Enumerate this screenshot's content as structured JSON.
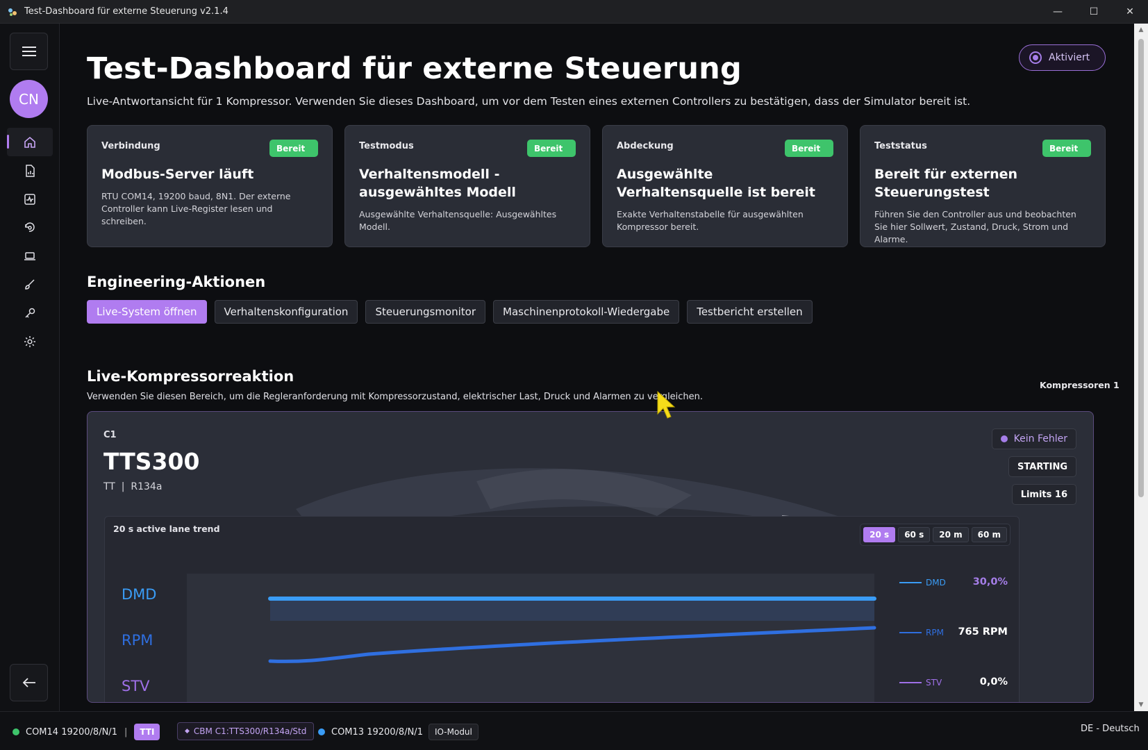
{
  "window": {
    "title": "Test-Dashboard für externe Steuerung v2.1.4",
    "minimize": "—",
    "maximize": "☐",
    "close": "✕"
  },
  "sidebar": {
    "avatar_initials": "CN",
    "items": [
      {
        "icon": "home-icon",
        "active": true
      },
      {
        "icon": "document-chart-icon",
        "active": false
      },
      {
        "icon": "activity-icon",
        "active": false
      },
      {
        "icon": "refresh-search-icon",
        "active": false
      },
      {
        "icon": "laptop-icon",
        "active": false
      },
      {
        "icon": "brush-icon",
        "active": false
      },
      {
        "icon": "key-icon",
        "active": false
      },
      {
        "icon": "gear-icon",
        "active": false
      }
    ]
  },
  "header": {
    "title": "Test-Dashboard für externe Steuerung",
    "subtitle": "Live-Antwortansicht für 1 Kompressor. Verwenden Sie dieses Dashboard, um vor dem Testen eines externen Controllers zu bestätigen, dass der Simulator bereit ist.",
    "status_pill": "Aktiviert"
  },
  "cards": [
    {
      "label": "Verbindung",
      "badge": "Bereit",
      "title": "Modbus-Server läuft",
      "desc": "RTU COM14, 19200 baud, 8N1. Der externe Controller kann Live-Register lesen und schreiben."
    },
    {
      "label": "Testmodus",
      "badge": "Bereit",
      "title": "Verhaltensmodell - ausgewähltes Modell",
      "desc": "Ausgewählte Verhaltensquelle: Ausgewähltes Modell."
    },
    {
      "label": "Abdeckung",
      "badge": "Bereit",
      "title": "Ausgewählte Verhaltensquelle ist bereit",
      "desc": "Exakte Verhaltenstabelle für ausgewählten Kompressor bereit."
    },
    {
      "label": "Teststatus",
      "badge": "Bereit",
      "title": "Bereit für externen Steuerungstest",
      "desc": "Führen Sie den Controller aus und beobachten Sie hier Sollwert, Zustand, Druck, Strom und Alarme."
    }
  ],
  "engineering": {
    "title": "Engineering-Aktionen",
    "actions": [
      "Live-System öffnen",
      "Verhaltenskonfiguration",
      "Steuerungsmonitor",
      "Maschinenprotokoll-Wiedergabe",
      "Testbericht erstellen"
    ]
  },
  "live": {
    "title": "Live-Kompressorreaktion",
    "subtitle": "Verwenden Sie diesen Bereich, um die Regleranforderung mit Kompressorzustand, elektrischer Last, Druck und Alarmen zu vergleichen.",
    "count": "Kompressoren 1",
    "compressor": {
      "id": "C1",
      "model": "TTS300",
      "type": "TT",
      "separator": "|",
      "refrigerant": "R134a",
      "fault": "Kein Fehler",
      "state": "STARTING",
      "limits": "Limits 16"
    },
    "trend": {
      "label": "20 s active lane trend",
      "ranges": [
        "20 s",
        "60 s",
        "20 m",
        "60 m"
      ],
      "selected_range": "20 s",
      "lanes": [
        {
          "name": "DMD",
          "legend": "DMD",
          "value": "30,0%",
          "color": "#3a9cf5",
          "level": 0.3
        },
        {
          "name": "RPM",
          "legend": "RPM",
          "value": "765 RPM",
          "color": "#2f6fe0"
        },
        {
          "name": "STV",
          "legend": "STV",
          "value": "0,0%",
          "color": "#9f70e8"
        }
      ]
    }
  },
  "statusbar": {
    "port1": "COM14 19200/8/N/1",
    "sep": "|",
    "port1_tag": "TTI",
    "cbm": "CBM C1:TTS300/R134a/Std",
    "port2": "COM13 19200/8/N/1",
    "io_module": "IO-Modul",
    "language": "DE - Deutsch"
  },
  "colors": {
    "accent": "#b07cf0",
    "ready": "#3ec46b",
    "dmd": "#3a9cf5",
    "rpm": "#2f6fe0",
    "stv": "#9f70e8"
  }
}
